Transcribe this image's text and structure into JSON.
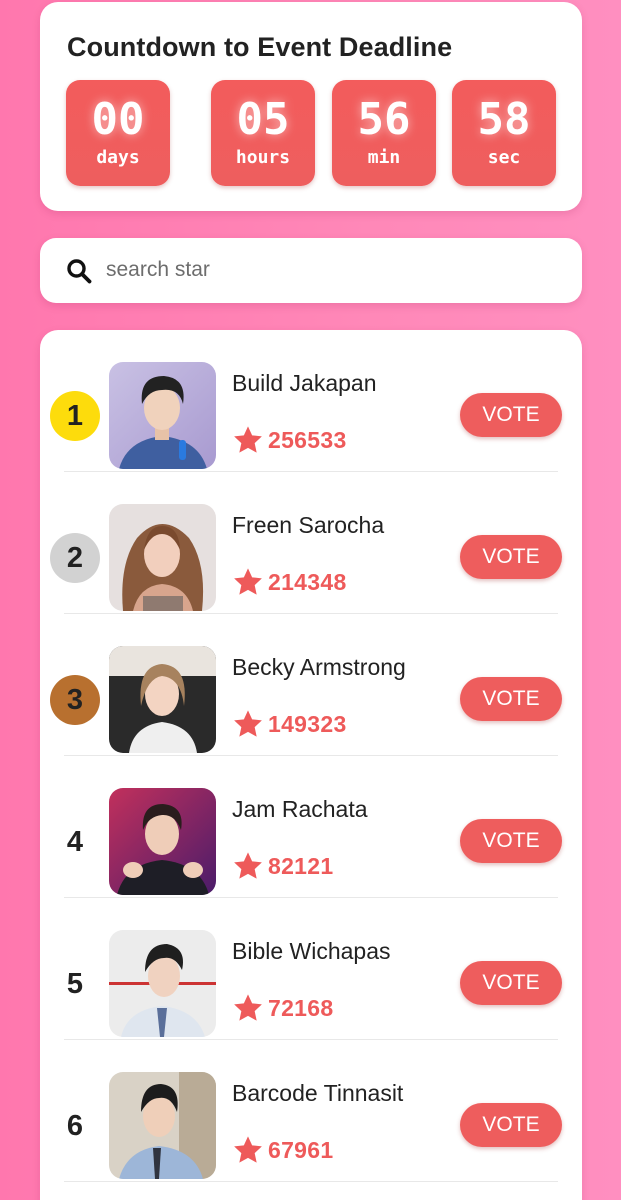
{
  "countdown": {
    "title": "Countdown to Event Deadline",
    "days": {
      "value": "00",
      "unit": "days"
    },
    "hours": {
      "value": "05",
      "unit": "hours"
    },
    "minutes": {
      "value": "56",
      "unit": "min"
    },
    "seconds": {
      "value": "58",
      "unit": "sec"
    }
  },
  "search": {
    "placeholder": "search star",
    "value": "",
    "icon": "search-icon"
  },
  "colors": {
    "accent": "#ee5d5d",
    "background": "#ff7eb3",
    "gold": "#fddc0c",
    "silver": "#d2d2d2",
    "bronze": "#b8702f"
  },
  "ranking": [
    {
      "rank": "1",
      "name": "Build Jakapan",
      "votes": "256533",
      "vote_label": "VOTE",
      "medal": "gold"
    },
    {
      "rank": "2",
      "name": "Freen Sarocha",
      "votes": "214348",
      "vote_label": "VOTE",
      "medal": "silver"
    },
    {
      "rank": "3",
      "name": "Becky Armstrong",
      "votes": "149323",
      "vote_label": "VOTE",
      "medal": "bronze"
    },
    {
      "rank": "4",
      "name": "Jam Rachata",
      "votes": "82121",
      "vote_label": "VOTE",
      "medal": "none"
    },
    {
      "rank": "5",
      "name": "Bible Wichapas",
      "votes": "72168",
      "vote_label": "VOTE",
      "medal": "none"
    },
    {
      "rank": "6",
      "name": "Barcode Tinnasit",
      "votes": "67961",
      "vote_label": "VOTE",
      "medal": "none"
    }
  ]
}
